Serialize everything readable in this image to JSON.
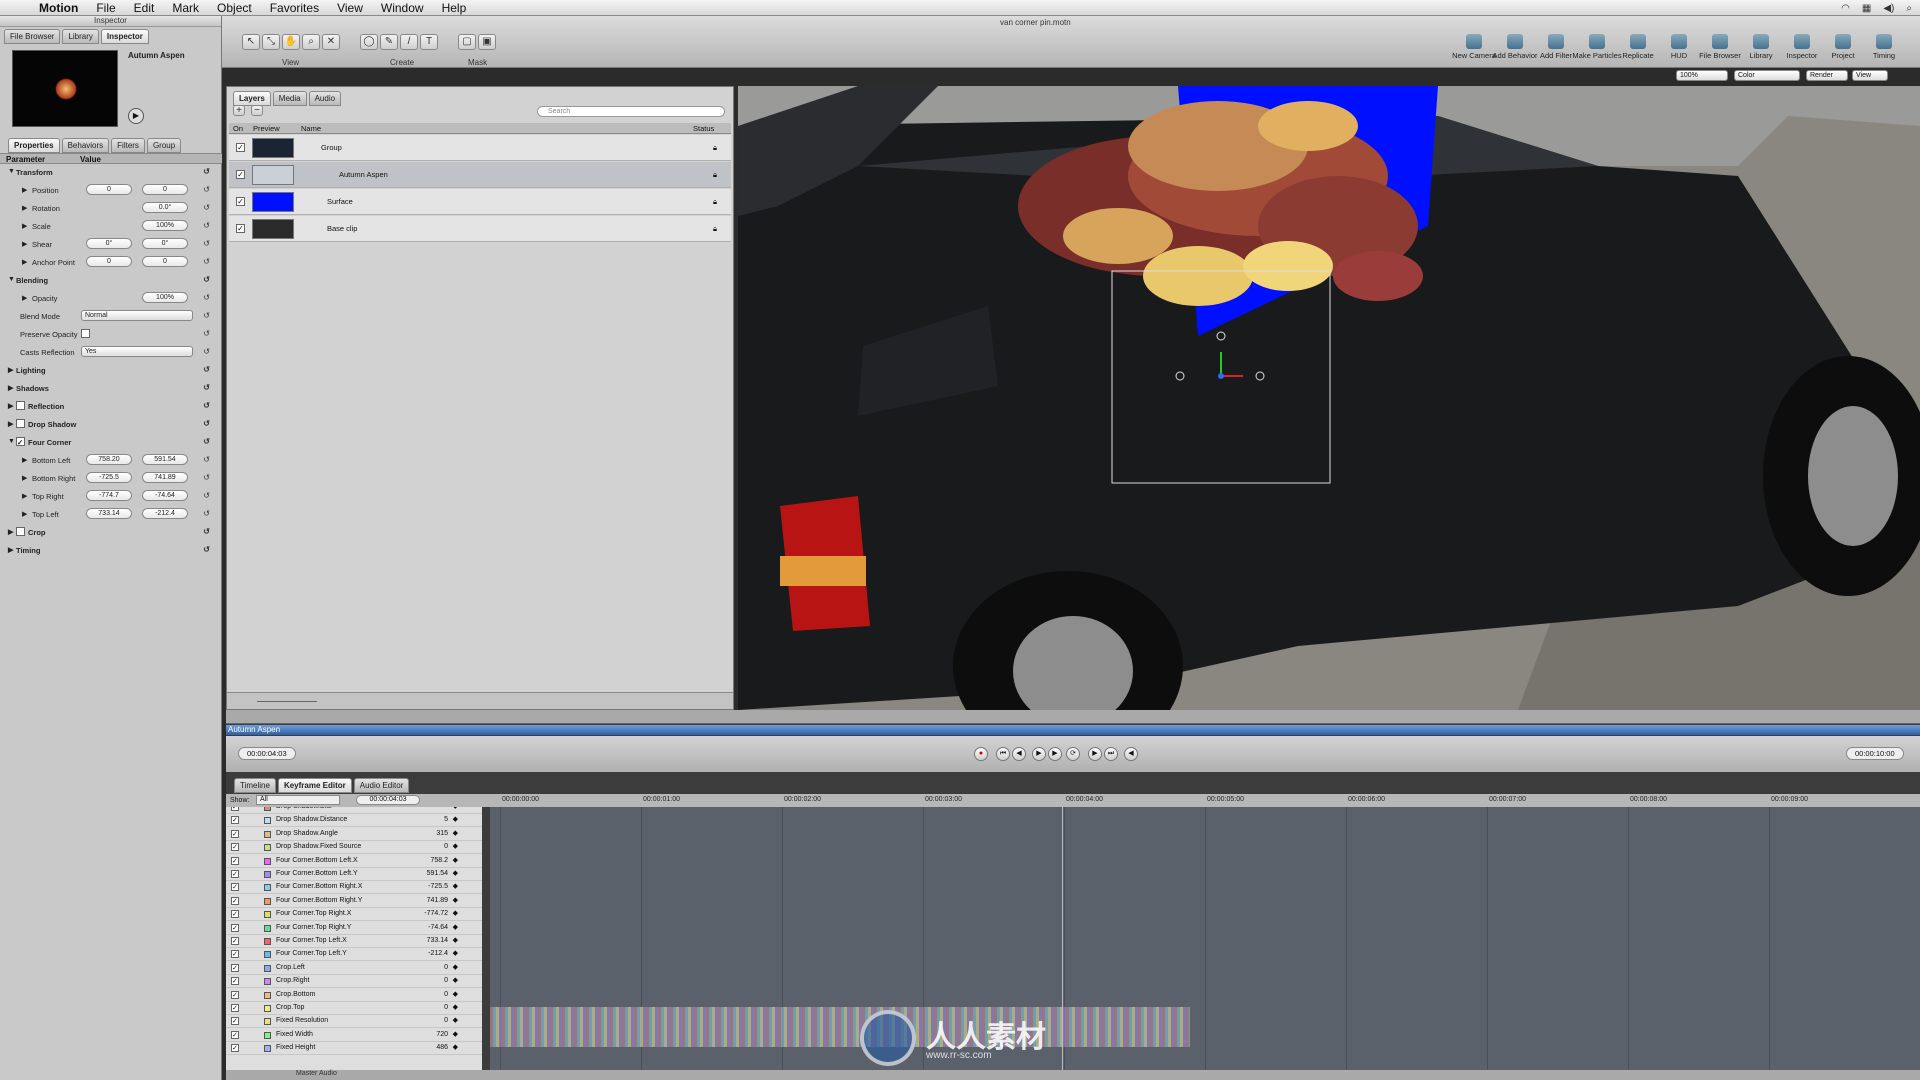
{
  "menubar": {
    "app": "Motion",
    "items": [
      "File",
      "Edit",
      "Mark",
      "Object",
      "Favorites",
      "View",
      "Window",
      "Help"
    ]
  },
  "window": {
    "title": "van corner pin.motn"
  },
  "inspector": {
    "title": "Inspector",
    "top_tabs": [
      "File Browser",
      "Library",
      "Inspector"
    ],
    "object_name": "Autumn Aspen",
    "tabs": [
      "Properties",
      "Behaviors",
      "Filters",
      "Group"
    ],
    "header": {
      "parameter": "Parameter",
      "value": "Value"
    },
    "rows": [
      {
        "label": "Transform",
        "section": true
      },
      {
        "label": "Position",
        "v1": "0",
        "v2": "0"
      },
      {
        "label": "Rotation",
        "v2": "0.0°"
      },
      {
        "label": "Scale",
        "v2": "100%"
      },
      {
        "label": "Shear",
        "v1": "0°",
        "v2": "0°"
      },
      {
        "label": "Anchor Point",
        "v1": "0",
        "v2": "0"
      },
      {
        "label": "Blending",
        "section": true
      },
      {
        "label": "Opacity",
        "v2": "100%"
      },
      {
        "label": "Blend Mode",
        "dropdown": "Normal"
      },
      {
        "label": "Preserve Opacity",
        "checkbox": true
      },
      {
        "label": "Casts Reflection",
        "dropdown": "Yes"
      },
      {
        "label": "Lighting",
        "section": true
      },
      {
        "label": "Shadows",
        "section": true
      },
      {
        "label": "Reflection",
        "section": true
      },
      {
        "label": "Drop Shadow",
        "section": true
      },
      {
        "label": "Four Corner",
        "section": true
      },
      {
        "label": "Bottom Left",
        "v1": "758.20",
        "v2": "591.54"
      },
      {
        "label": "Bottom Right",
        "v1": "-725.5",
        "v2": "741.89"
      },
      {
        "label": "Top Right",
        "v1": "-774.7",
        "v2": "-74.64"
      },
      {
        "label": "Top Left",
        "v1": "733.14",
        "v2": "-212.4"
      },
      {
        "label": "Crop",
        "section": true
      },
      {
        "label": "Timing",
        "section": true
      }
    ]
  },
  "toolbar": {
    "groups": [
      "View",
      "Create",
      "Mask"
    ],
    "right_items": [
      "New Camera",
      "Add Behavior",
      "Add Filter",
      "Make Particles",
      "Replicate",
      "HUD",
      "File Browser",
      "Library",
      "Inspector",
      "Project",
      "Timing"
    ],
    "zoom": "100%",
    "channel": "Color",
    "render": "Render",
    "view": "View"
  },
  "layers": {
    "tabs": [
      "Layers",
      "Media",
      "Audio"
    ],
    "search_placeholder": "Search",
    "columns": [
      "On",
      "Preview",
      "Name",
      "Status"
    ],
    "rows": [
      {
        "name": "Group",
        "preview": "#1b2432"
      },
      {
        "name": "Autumn Aspen",
        "preview": "#c9d0d8"
      },
      {
        "name": "Surface",
        "preview": "#0010ff"
      },
      {
        "name": "Base clip",
        "preview": "#2a2a2a"
      }
    ]
  },
  "timeline": {
    "object_name": "Autumn Aspen",
    "current_time": "00:00:04:03",
    "duration": "00:00:10:00",
    "tabs": [
      "Timeline",
      "Keyframe Editor",
      "Audio Editor"
    ],
    "show_label": "Show:",
    "show_value": "All",
    "ruler": [
      "00:00:00:00",
      "00:00:01:00",
      "00:00:02:00",
      "00:00:03:00",
      "00:00:04:00",
      "00:00:05:00",
      "00:00:06:00",
      "00:00:07:00",
      "00:00:08:00",
      "00:00:09:00"
    ],
    "params": [
      {
        "name": "Drop Shadow.Blur",
        "value": "",
        "color": "#d88"
      },
      {
        "name": "Drop Shadow.Distance",
        "value": "5",
        "color": "#bde"
      },
      {
        "name": "Drop Shadow.Angle",
        "value": "315",
        "color": "#db8"
      },
      {
        "name": "Drop Shadow.Fixed Source",
        "value": "0",
        "color": "#cd8"
      },
      {
        "name": "Four Corner.Bottom Left.X",
        "value": "758.2",
        "color": "#e6e"
      },
      {
        "name": "Four Corner.Bottom Left.Y",
        "value": "591.54",
        "color": "#a8e"
      },
      {
        "name": "Four Corner.Bottom Right.X",
        "value": "-725.5",
        "color": "#8ce"
      },
      {
        "name": "Four Corner.Bottom Right.Y",
        "value": "741.89",
        "color": "#e96"
      },
      {
        "name": "Four Corner.Top Right.X",
        "value": "-774.72",
        "color": "#dd6"
      },
      {
        "name": "Four Corner.Top Right.Y",
        "value": "-74.64",
        "color": "#6d9"
      },
      {
        "name": "Four Corner.Top Left.X",
        "value": "733.14",
        "color": "#e66"
      },
      {
        "name": "Four Corner.Top Left.Y",
        "value": "-212.4",
        "color": "#6be"
      },
      {
        "name": "Crop.Left",
        "value": "0",
        "color": "#8ae"
      },
      {
        "name": "Crop.Right",
        "value": "0",
        "color": "#c8e"
      },
      {
        "name": "Crop.Bottom",
        "value": "0",
        "color": "#eb8"
      },
      {
        "name": "Crop.Top",
        "value": "0",
        "color": "#ee8"
      },
      {
        "name": "Fixed Resolution",
        "value": "0",
        "color": "#ed8"
      },
      {
        "name": "Fixed Width",
        "value": "720",
        "color": "#8e8"
      },
      {
        "name": "Fixed Height",
        "value": "486",
        "color": "#aaf"
      }
    ],
    "footer": "Master Audio"
  },
  "watermark": {
    "text": "人人素材",
    "url": "www.rr-sc.com"
  }
}
